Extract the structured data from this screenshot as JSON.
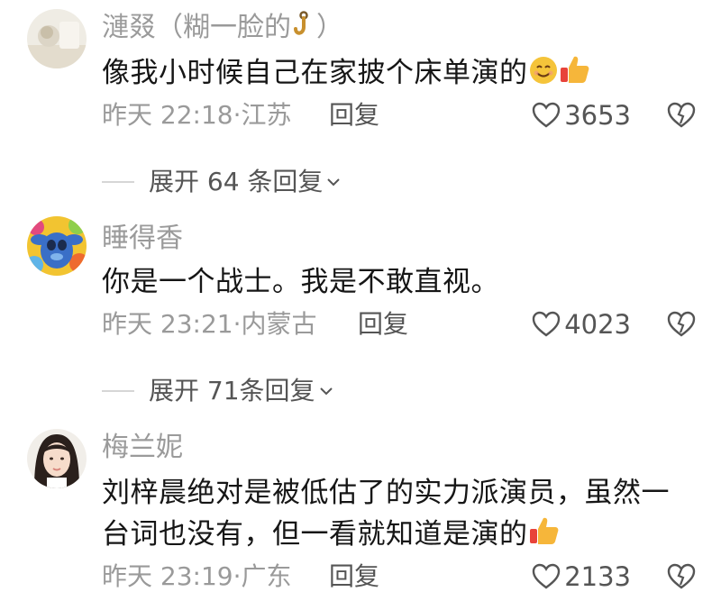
{
  "comments": [
    {
      "username": "漣叕（糊一脸的",
      "username_suffix": "）",
      "text": "像我小时候自己在家披个床单演的",
      "time_location": "昨天 22:18·江苏",
      "reply_label": "回复",
      "likes": "3653",
      "expand": "展开 64 条回复",
      "emoji_icons": [
        "smiling-face-icon",
        "thumbs-up-icon"
      ]
    },
    {
      "username": "睡得香",
      "text": "你是一个战士。我是不敢直视。",
      "time_location": "昨天 23:21·内蒙古",
      "reply_label": "回复",
      "likes": "4023",
      "expand": "展开 71条回复"
    },
    {
      "username": "梅兰妮",
      "text": "刘梓晨绝对是被低估了的实力派演员，虽然一台词也没有，但一看就知道是演的",
      "time_location": "昨天 23:19·广东",
      "reply_label": "回复",
      "likes": "2133",
      "emoji_icons": [
        "thumbs-up-icon"
      ]
    }
  ],
  "colors": {
    "meta_gray": "#9a9a9a",
    "body_text": "#161616",
    "divider": "#d6d6d6"
  }
}
